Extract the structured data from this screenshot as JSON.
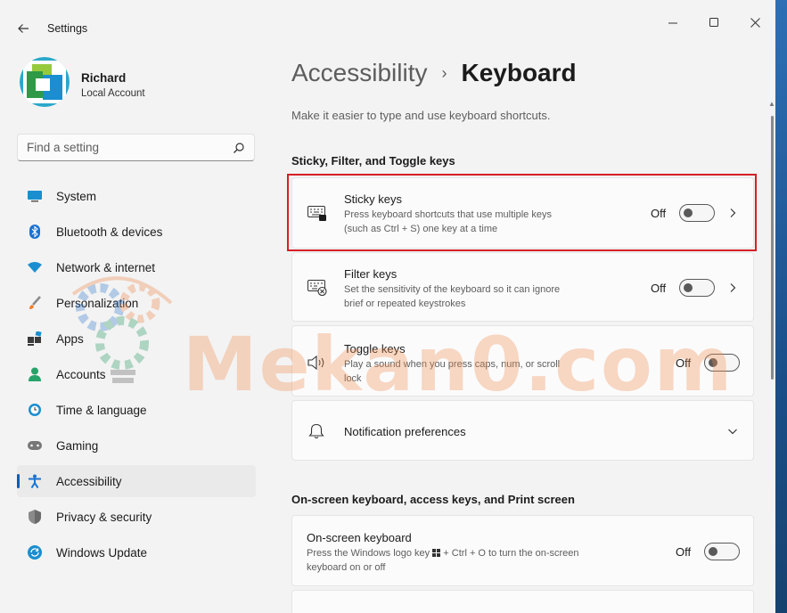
{
  "window": {
    "title": "Settings",
    "controls": {
      "minimize": "—",
      "maximize": "☐",
      "close": "✕"
    }
  },
  "profile": {
    "name": "Richard",
    "account_type": "Local Account"
  },
  "search": {
    "placeholder": "Find a setting"
  },
  "nav": {
    "items": [
      {
        "label": "System",
        "icon": "system-icon"
      },
      {
        "label": "Bluetooth & devices",
        "icon": "bluetooth-icon"
      },
      {
        "label": "Network & internet",
        "icon": "wifi-icon"
      },
      {
        "label": "Personalization",
        "icon": "brush-icon"
      },
      {
        "label": "Apps",
        "icon": "apps-icon"
      },
      {
        "label": "Accounts",
        "icon": "person-icon"
      },
      {
        "label": "Time & language",
        "icon": "clock-globe-icon"
      },
      {
        "label": "Gaming",
        "icon": "gamepad-icon"
      },
      {
        "label": "Accessibility",
        "icon": "accessibility-icon",
        "active": true
      },
      {
        "label": "Privacy & security",
        "icon": "shield-icon"
      },
      {
        "label": "Windows Update",
        "icon": "update-icon"
      }
    ]
  },
  "header": {
    "breadcrumb_parent": "Accessibility",
    "breadcrumb_separator": "›",
    "breadcrumb_current": "Keyboard",
    "subtitle": "Make it easier to type and use keyboard shortcuts."
  },
  "sections": {
    "sticky": {
      "title": "Sticky, Filter, and Toggle keys",
      "cards": [
        {
          "title": "Sticky keys",
          "desc": "Press keyboard shortcuts that use multiple keys (such as Ctrl + S) one key at a time",
          "state": "Off",
          "on": false,
          "icon": "sticky-keys-icon"
        },
        {
          "title": "Filter keys",
          "desc": "Set the sensitivity of the keyboard so it can ignore brief or repeated keystrokes",
          "state": "Off",
          "on": false,
          "icon": "filter-keys-icon"
        },
        {
          "title": "Toggle keys",
          "desc": "Play a sound when you press caps, num, or scroll lock",
          "state": "Off",
          "on": false,
          "icon": "speaker-icon"
        },
        {
          "title": "Notification preferences",
          "icon": "bell-icon"
        }
      ]
    },
    "onscreen": {
      "title": "On-screen keyboard, access keys, and Print screen",
      "cards": [
        {
          "title": "On-screen keyboard",
          "desc_before": "Press the Windows logo key",
          "desc_after": "+ Ctrl + O to turn the on-screen keyboard on or off",
          "state": "Off",
          "on": false
        }
      ]
    }
  },
  "watermark": {
    "text": "Mekan0.com"
  },
  "colors": {
    "accent": "#005fb8",
    "highlight": "#d62027",
    "background": "#f3f3f3",
    "card": "#fbfbfb"
  }
}
